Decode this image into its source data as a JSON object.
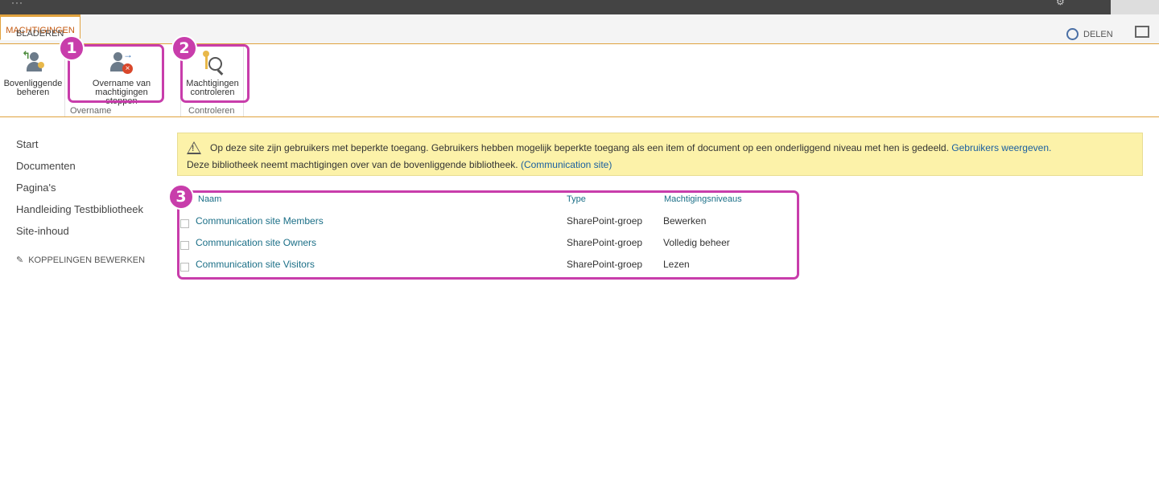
{
  "ribbon": {
    "tabs": [
      "BLADEREN",
      "MACHTIGINGEN"
    ],
    "share_label": "DELEN",
    "buttons": {
      "manage_parent": {
        "line1": "Bovenliggende",
        "line2": "beheren"
      },
      "stop_inherit": {
        "line1": "Overname van machtigingen",
        "line2": "stoppen"
      },
      "check_perm": {
        "line1": "Machtigingen",
        "line2": "controleren"
      }
    },
    "groups": [
      "Overname",
      "Controleren"
    ]
  },
  "badges": [
    "1",
    "2",
    "3"
  ],
  "nav": {
    "items": [
      "Start",
      "Documenten",
      "Pagina's",
      "Handleiding Testbibliotheek",
      "Site-inhoud"
    ],
    "edit_links": "KOPPELINGEN BEWERKEN"
  },
  "notice": {
    "line1_text": "Op deze site zijn gebruikers met beperkte toegang. Gebruikers hebben mogelijk beperkte toegang als een item of document op een onderliggend niveau met hen is gedeeld.",
    "line1_link": "Gebruikers weergeven.",
    "line2_text": "Deze bibliotheek neemt machtigingen over van de bovenliggende bibliotheek.",
    "line2_link": "(Communication site)"
  },
  "table": {
    "headers": {
      "name": "Naam",
      "type": "Type",
      "level": "Machtigingsniveaus"
    },
    "rows": [
      {
        "name": "Communication site Members",
        "type": "SharePoint-groep",
        "level": "Bewerken"
      },
      {
        "name": "Communication site Owners",
        "type": "SharePoint-groep",
        "level": "Volledig beheer"
      },
      {
        "name": "Communication site Visitors",
        "type": "SharePoint-groep",
        "level": "Lezen"
      }
    ]
  },
  "colors": {
    "highlight": "#c83dab",
    "accent": "#e0a23e",
    "link": "#1b6f87"
  }
}
